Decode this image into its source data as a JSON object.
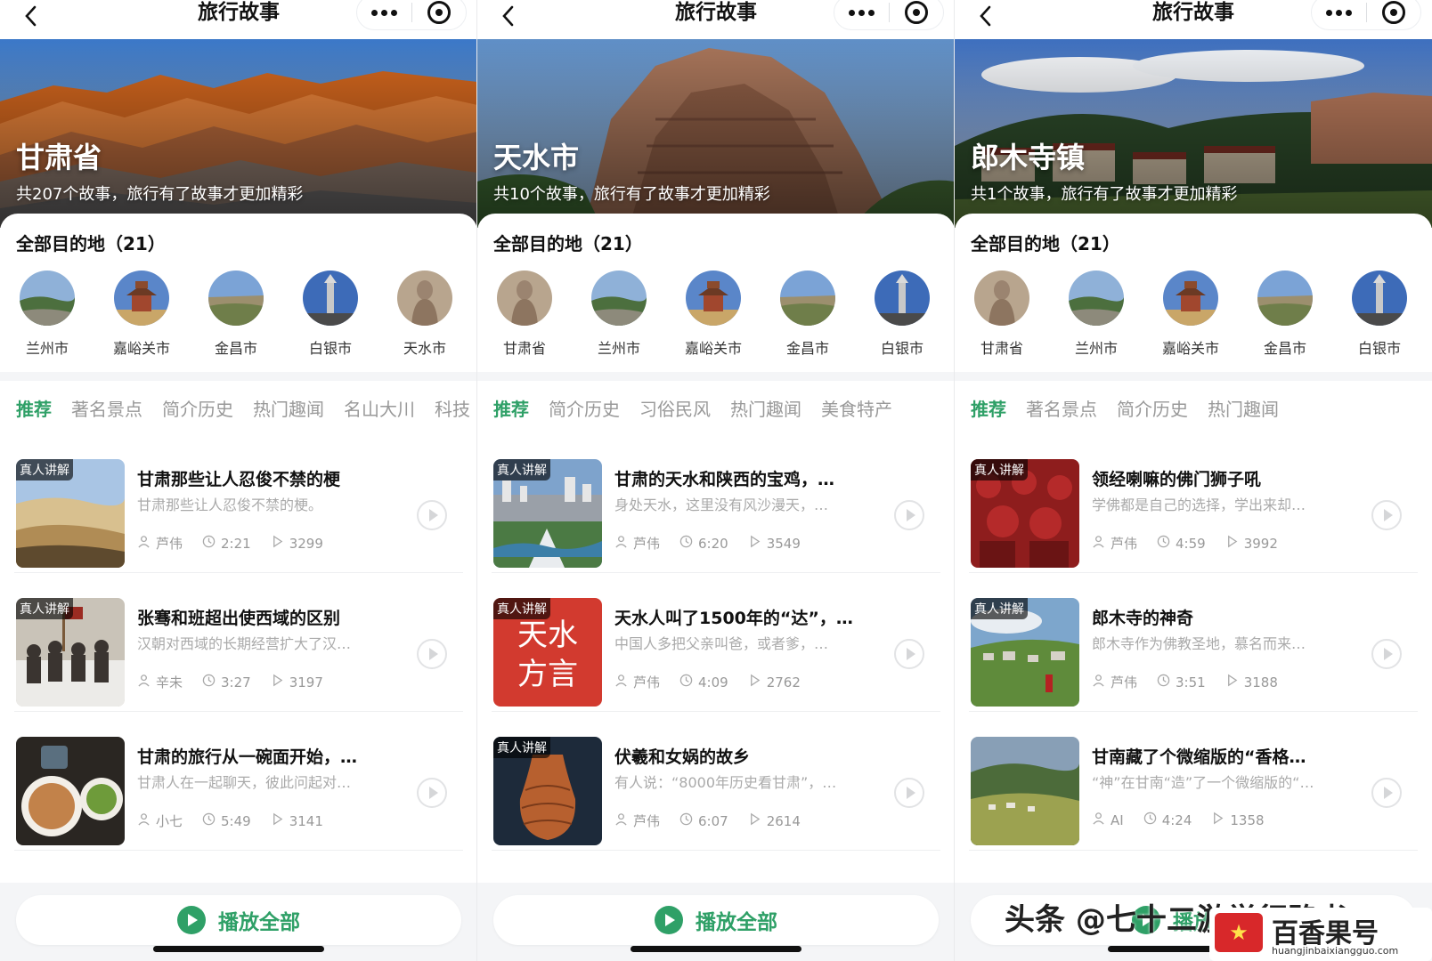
{
  "colors": {
    "accent": "#2fa067",
    "muted": "#999999",
    "tab_highlight": "#ffe24a"
  },
  "panels": [
    {
      "nav_title": "旅行故事",
      "hero": {
        "title": "甘肃省",
        "subtitle": "共207个故事，旅行有了故事才更加精彩",
        "scene": "danxia"
      },
      "dest_title": "全部目的地（21）",
      "destinations": [
        {
          "name": "兰州市",
          "img": "river"
        },
        {
          "name": "嘉峪关市",
          "img": "pagoda"
        },
        {
          "name": "金昌市",
          "img": "plain"
        },
        {
          "name": "白银市",
          "img": "tower"
        },
        {
          "name": "天水市",
          "img": "buddha"
        }
      ],
      "tabs": [
        "推荐",
        "著名景点",
        "简介历史",
        "热门趣闻",
        "名山大川",
        "科技"
      ],
      "stories": [
        {
          "badge": "真人讲解",
          "title": "甘肃那些让人忍俊不禁的梗",
          "desc": "甘肃那些让人忍俊不禁的梗。",
          "author": "芦伟",
          "duration": "2:21",
          "plays": "3299",
          "thumb": "desert"
        },
        {
          "badge": "真人讲解",
          "title": "张骞和班超出使西域的区别",
          "desc": "汉朝对西域的长期经营扩大了汉…",
          "author": "辛未",
          "duration": "3:27",
          "plays": "3197",
          "thumb": "crowd"
        },
        {
          "badge": "",
          "title": "甘肃的旅行从一碗面开始，…",
          "desc": "甘肃人在一起聊天，彼此问起对…",
          "author": "小七",
          "duration": "5:49",
          "plays": "3141",
          "thumb": "noodle"
        }
      ],
      "play_all": "播放全部"
    },
    {
      "nav_title": "旅行故事",
      "hero": {
        "title": "天水市",
        "subtitle": "共10个故事，旅行有了故事才更加精彩",
        "scene": "cliff"
      },
      "dest_title": "全部目的地（21）",
      "destinations": [
        {
          "name": "甘肃省",
          "img": "buddha"
        },
        {
          "name": "兰州市",
          "img": "river"
        },
        {
          "name": "嘉峪关市",
          "img": "pagoda"
        },
        {
          "name": "金昌市",
          "img": "plain"
        },
        {
          "name": "白银市",
          "img": "tower"
        }
      ],
      "tabs": [
        "推荐",
        "简介历史",
        "习俗民风",
        "热门趣闻",
        "美食特产"
      ],
      "stories": [
        {
          "badge": "真人讲解",
          "title": "甘肃的天水和陕西的宝鸡，…",
          "desc": "身处天水，这里没有风沙漫天，…",
          "author": "芦伟",
          "duration": "6:20",
          "plays": "3549",
          "thumb": "city"
        },
        {
          "badge": "真人讲解",
          "title": "天水人叫了1500年的“达”，…",
          "desc": "中国人多把父亲叫爸，或者爹，…",
          "author": "芦伟",
          "duration": "4:09",
          "plays": "2762",
          "thumb": "dialect",
          "thumb_text": [
            "天水",
            "方言"
          ]
        },
        {
          "badge": "真人讲解",
          "title": "伏羲和女娲的故乡",
          "desc": "有人说：“8000年历史看甘肃”，…",
          "author": "芦伟",
          "duration": "6:07",
          "plays": "2614",
          "thumb": "vase"
        }
      ],
      "play_all": "播放全部"
    },
    {
      "nav_title": "旅行故事",
      "hero": {
        "title": "郎木寺镇",
        "subtitle": "共1个故事，旅行有了故事才更加精彩",
        "scene": "temple"
      },
      "dest_title": "全部目的地（21）",
      "destinations": [
        {
          "name": "甘肃省",
          "img": "buddha"
        },
        {
          "name": "兰州市",
          "img": "river"
        },
        {
          "name": "嘉峪关市",
          "img": "pagoda"
        },
        {
          "name": "金昌市",
          "img": "plain"
        },
        {
          "name": "白银市",
          "img": "tower"
        }
      ],
      "tabs": [
        "推荐",
        "著名景点",
        "简介历史",
        "热门趣闻"
      ],
      "stories": [
        {
          "badge": "真人讲解",
          "title": "领经喇嘛的佛门狮子吼",
          "desc": "学佛都是自己的选择，学出来却…",
          "author": "芦伟",
          "duration": "4:59",
          "plays": "3992",
          "thumb": "monks"
        },
        {
          "badge": "真人讲解",
          "title": "郎木寺的神奇",
          "desc": "郎木寺作为佛教圣地，慕名而来…",
          "author": "芦伟",
          "duration": "3:51",
          "plays": "3188",
          "thumb": "meadow"
        },
        {
          "badge": "",
          "title": "甘南藏了个微缩版的“香格…",
          "desc": "“神”在甘南“造”了一个微缩版的“…",
          "author": "AI",
          "duration": "4:24",
          "plays": "1358",
          "thumb": "valley"
        }
      ],
      "play_all": "播放全部"
    }
  ],
  "watermark": {
    "left": "头条 @七十二游学行路书",
    "brand": "百香果号",
    "url": "huangjinbaixiangguo.com"
  }
}
